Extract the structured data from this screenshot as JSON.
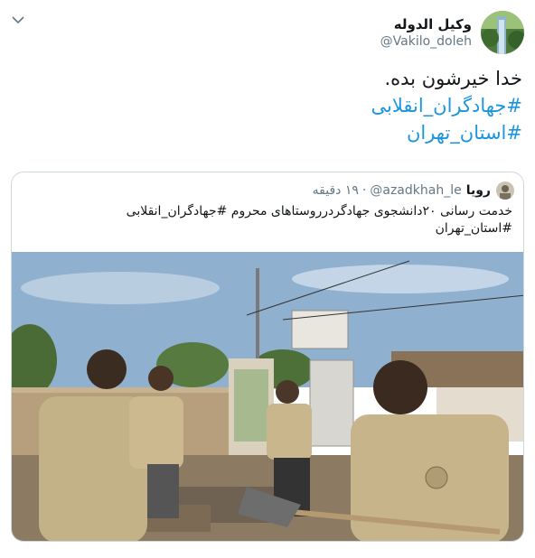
{
  "author": {
    "display_name": "وکیل الدوله",
    "handle": "@Vakilo_doleh",
    "avatar_icon": "avatar-photo"
  },
  "menu": {
    "icon": "chevron-down-icon"
  },
  "tweet": {
    "line1": "خدا خیرشون بده.",
    "line2": "#جهادگران_انقلابی",
    "line3": "#استان_تهران"
  },
  "quoted": {
    "display_name": "رویا",
    "handle": "@azadkhah_le",
    "separator": "·",
    "time": "۱۹ دقیقه",
    "text_line1": "خدمت رسانی ۲۰دانشجوی جهادگردرروستاهای محروم #جهادگران_انقلابی",
    "text_line2": "#استان_تهران",
    "photo_icon": "photo-workers-shoveling"
  },
  "colors": {
    "link": "#1b95e0",
    "secondary": "#657786",
    "border": "#ccd6dd"
  }
}
